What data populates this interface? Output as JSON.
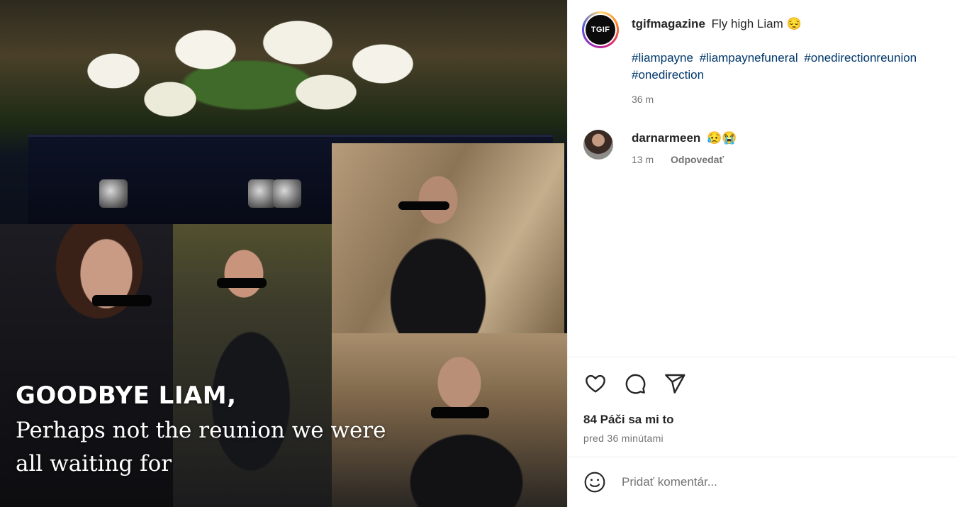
{
  "media": {
    "overlay_title": "GOODBYE LIAM,",
    "overlay_subtitle": "Perhaps not the reunion we were all waiting for"
  },
  "post": {
    "avatar_text": "TGIF",
    "username": "tgifmagazine",
    "caption": "Fly high Liam 😔",
    "hashtags": [
      "#liampayne",
      "#liampaynefuneral",
      "#onedirectionreunion",
      "#onedirection"
    ],
    "time": "36 m"
  },
  "comments": [
    {
      "username": "darnarmeen",
      "text": "😥😭",
      "time": "13 m",
      "reply_label": "Odpovedať"
    }
  ],
  "actions": {
    "icons": [
      "heart-icon",
      "comment-icon",
      "share-icon"
    ],
    "likes_label": "84 Páči sa mi to",
    "posted_time": "pred 36 minútami"
  },
  "add_comment": {
    "placeholder": "Pridať komentár...",
    "emoji_icon": "smiley-icon"
  }
}
